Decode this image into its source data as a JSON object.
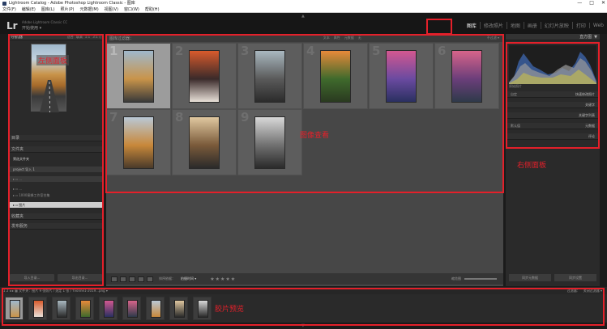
{
  "window": {
    "title": "Lightroom Catalog - Adobe Photoshop Lightroom Classic - 图库",
    "controls": [
      "—",
      "□",
      "✕"
    ]
  },
  "menu": [
    "文件(F)",
    "编辑(E)",
    "图库(L)",
    "照片(P)",
    "元数据(M)",
    "视图(V)",
    "窗口(W)",
    "帮助(H)"
  ],
  "identity": {
    "logo": "Lr",
    "adobe": "Adobe Lightroom Classic CC",
    "user": "开始使用 ▾"
  },
  "modules": [
    {
      "label": "图库",
      "active": true
    },
    {
      "label": "修改照片",
      "active": false
    },
    {
      "label": "地图",
      "active": false
    },
    {
      "label": "画册",
      "active": false
    },
    {
      "label": "幻灯片放映",
      "active": false
    },
    {
      "label": "打印",
      "active": false
    },
    {
      "label": "Web",
      "active": false
    }
  ],
  "left_panel": {
    "navigator": {
      "title": "导航器",
      "opts": [
        "适合",
        "填满",
        "1:1",
        "3:1 ◇"
      ]
    },
    "sections": {
      "catalog": "目录",
      "folders": "文件夹",
      "collections": "收藏夹",
      "publish": "发布服务"
    },
    "filter_folder": "筛选文件夹",
    "volume": "project 导入 1",
    "folder_rows": [
      "▸ ▫ ...",
      "▸ ▫ ...",
      "▸ ▫ 1000蜜蜂工作室合集",
      "▸ ▫ 图片"
    ],
    "buttons": {
      "import": "导入目录...",
      "export": "导出目录..."
    }
  },
  "center": {
    "filter_label": "图库过滤器：",
    "filter_tabs": [
      "文本",
      "属性",
      "元数据",
      "无"
    ],
    "filter_right": "不过滤 ▾",
    "photos": [
      {
        "n": "1",
        "sel": true,
        "colors": [
          "#9fb8cc",
          "#c9944a",
          "#3a3a3a"
        ]
      },
      {
        "n": "2",
        "sel": false,
        "colors": [
          "#d95b2c",
          "#3a2a2a",
          "#e8e0d8"
        ]
      },
      {
        "n": "3",
        "sel": false,
        "colors": [
          "#a9b8c0",
          "#5a5a5a",
          "#2b2b2b"
        ]
      },
      {
        "n": "4",
        "sel": false,
        "colors": [
          "#e88a3a",
          "#3f6a2c",
          "#2a3a20"
        ]
      },
      {
        "n": "5",
        "sel": false,
        "colors": [
          "#d25890",
          "#6a4aa0",
          "#2a3060"
        ]
      },
      {
        "n": "6",
        "sel": false,
        "colors": [
          "#d7648a",
          "#6b3e7a",
          "#2e3a4a"
        ]
      },
      {
        "n": "7",
        "sel": false,
        "colors": [
          "#b9c8d6",
          "#c8883a",
          "#4a3a2a"
        ]
      },
      {
        "n": "8",
        "sel": false,
        "colors": [
          "#e0c8a0",
          "#7a5a3a",
          "#2a2a2a"
        ]
      },
      {
        "n": "9",
        "sel": false,
        "colors": [
          "#d8d8d8",
          "#707070",
          "#2a2a2a"
        ]
      }
    ],
    "toolbar": {
      "sort_label": "排序依据：",
      "sort_value": "拍摄时间 ▾",
      "stars": "★★★★★",
      "thumb_label": "缩览图"
    }
  },
  "right_panel": {
    "histogram": "直方图",
    "orig_label": "原始照片",
    "rows": [
      {
        "l": "自定",
        "r": "快速修改照片"
      },
      {
        "l": "",
        "r": "关键字"
      },
      {
        "l": "",
        "r": "关键字列表"
      },
      {
        "l": "默认值",
        "r": "元数据"
      },
      {
        "l": "",
        "r": "评论"
      }
    ],
    "buttons": {
      "sync_meta": "同步元数据",
      "sync_settings": "同步设置"
    }
  },
  "filmstrip": {
    "crumb": "1  2  ◂ ▸  ▦  文件夹：图片  9 张照片 / 选定 1 张 / Yvonne1-2019...png ▾",
    "right": [
      "过滤器：",
      "关闭过滤器 ▾"
    ],
    "thumbs": [
      {
        "sel": true,
        "colors": [
          "#9fb8cc",
          "#c9944a"
        ]
      },
      {
        "sel": false,
        "colors": [
          "#d95b2c",
          "#e8e0d8"
        ]
      },
      {
        "sel": false,
        "colors": [
          "#a9b8c0",
          "#2b2b2b"
        ]
      },
      {
        "sel": false,
        "colors": [
          "#e88a3a",
          "#3f6a2c"
        ]
      },
      {
        "sel": false,
        "colors": [
          "#d25890",
          "#2a3060"
        ]
      },
      {
        "sel": false,
        "colors": [
          "#d7648a",
          "#2e3a4a"
        ]
      },
      {
        "sel": false,
        "colors": [
          "#b9c8d6",
          "#c8883a"
        ]
      },
      {
        "sel": false,
        "colors": [
          "#e0c8a0",
          "#2a2a2a"
        ]
      },
      {
        "sel": false,
        "colors": [
          "#d8d8d8",
          "#2a2a2a"
        ]
      }
    ]
  },
  "annotations": {
    "left": "左侧面板",
    "grid": "图像查看",
    "right": "右侧面板",
    "film": "胶片预览"
  },
  "accent": "#e4202a"
}
